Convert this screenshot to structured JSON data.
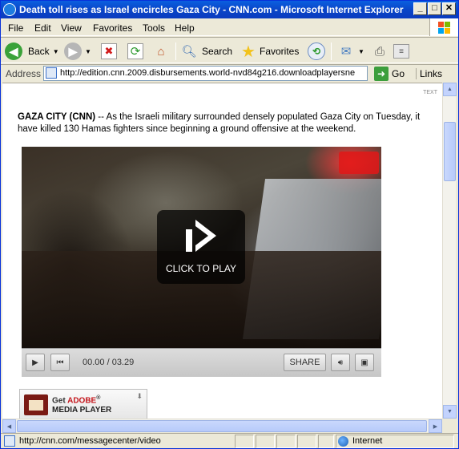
{
  "window": {
    "title": "Death toll rises as Israel encircles Gaza City - CNN.com - Microsoft Internet Explorer",
    "minimize": "_",
    "maximize": "□",
    "close": "✕"
  },
  "menu": [
    "File",
    "Edit",
    "View",
    "Favorites",
    "Tools",
    "Help"
  ],
  "toolbar": {
    "back": "Back",
    "search": "Search",
    "favorites": "Favorites"
  },
  "address": {
    "label": "Address",
    "url": "http://edition.cnn.2009.disbursements.world-nvd84g216.downloadplayersne",
    "go": "Go",
    "links": "Links"
  },
  "page": {
    "text_badge": "TEXT",
    "dateline": "GAZA CITY (CNN)",
    "lead_1": " -- As the Israeli military surrounded densely populated Gaza City on Tuesday, it",
    "lead_2": "have killed 130 Hamas fighters since beginning a ground offensive at the weekend.",
    "player": {
      "cta": "CLICK TO PLAY",
      "time": "00.00 / 03.29",
      "share": "SHARE"
    },
    "adobe": {
      "get": "Get",
      "brand": "ADOBE",
      "reg": "®",
      "product": "MEDIA PLAYER"
    }
  },
  "status": {
    "text": "http://cnn.com/messagecenter/video",
    "zone": "Internet"
  },
  "icons": {
    "back": "back-arrow-icon",
    "forward": "forward-arrow-icon",
    "stop": "stop-icon",
    "refresh": "refresh-icon",
    "home": "home-icon",
    "search": "search-icon",
    "favorites": "favorites-star-icon",
    "history": "history-icon",
    "mail": "mail-icon",
    "print": "print-icon"
  }
}
